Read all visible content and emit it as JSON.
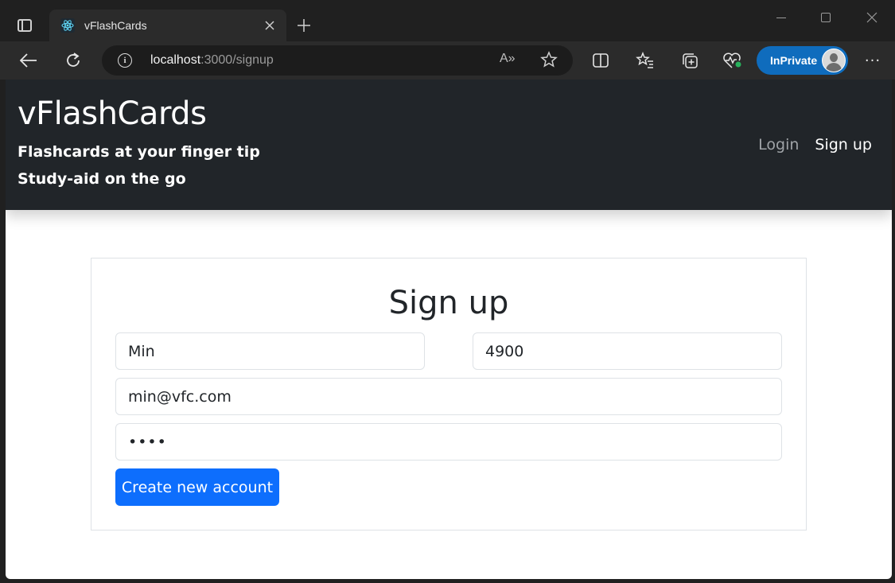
{
  "browser": {
    "tab_title": "vFlashCards",
    "url_host": "localhost",
    "url_rest": ":3000/signup",
    "inprivate_label": "InPrivate",
    "read_aloud_glyph": "A»",
    "more_glyph": "···",
    "icons": [
      "tab-actions-icon",
      "react-favicon-icon",
      "close-icon",
      "plus-icon",
      "back-arrow-icon",
      "reload-icon",
      "info-icon",
      "read-aloud-icon",
      "star-icon",
      "split-screen-icon",
      "favorites-icon",
      "collections-icon",
      "browser-essentials-icon",
      "profile-avatar-icon",
      "more-icon"
    ],
    "accent_color": "#0f6cbd"
  },
  "header": {
    "brand": "vFlashCards",
    "tagline_1": "Flashcards at your finger tip",
    "tagline_2": "Study-aid on the go",
    "nav_login": "Login",
    "nav_signup": "Sign up",
    "background_color": "#212529"
  },
  "form": {
    "title": "Sign up",
    "name_value": "Min",
    "number_value": "4900",
    "email_value": "min@vfc.com",
    "password_value": "••••",
    "submit_label": "Create new account",
    "button_color": "#0d6efd"
  }
}
